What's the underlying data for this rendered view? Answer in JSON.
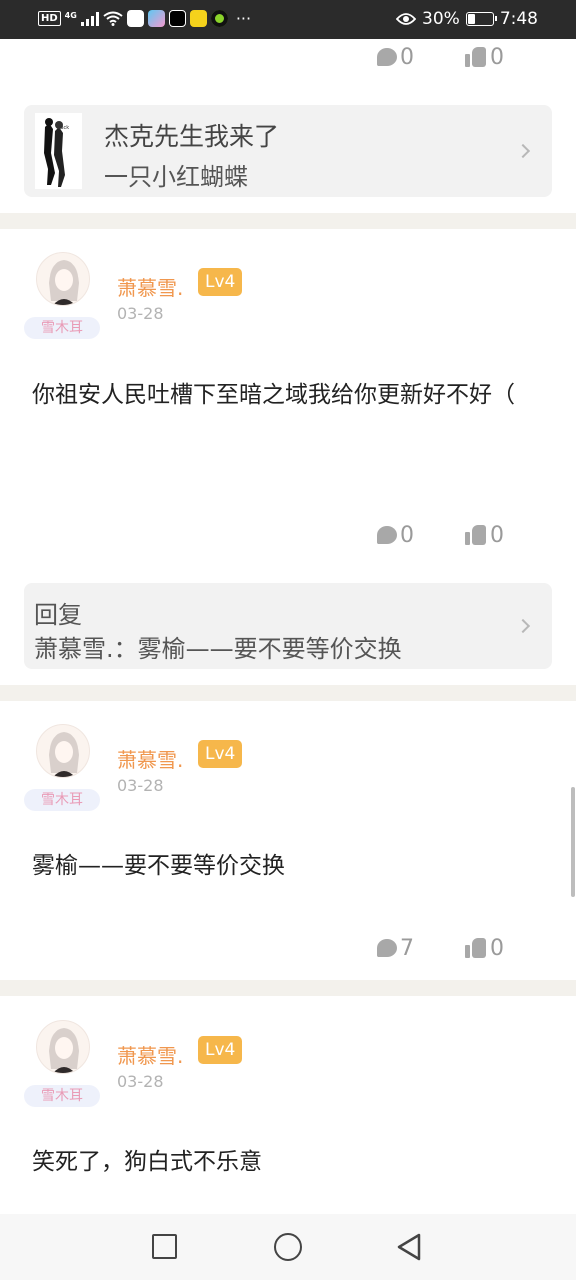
{
  "status_bar": {
    "hd": "HD",
    "network": "4G",
    "battery_percent": "30%",
    "battery_level": 0.3,
    "time": "7:48",
    "more": "···",
    "icons": [
      "wifi-icon",
      "app-icon",
      "app-icon",
      "capcut-icon",
      "app-icon",
      "app-icon",
      "eye-icon",
      "battery-icon"
    ]
  },
  "top_stats": {
    "comments": "0",
    "likes": "0"
  },
  "book_card": {
    "title": "杰克先生我来了",
    "author": "一只小红蝴蝶",
    "cover_caption": "Jack"
  },
  "posts": [
    {
      "username": "萧慕雪.",
      "level": "Lv4",
      "date": "03-28",
      "badge": "雪木耳",
      "content": "你祖安人民吐槽下至暗之域我给你更新好不好（",
      "comments": "0",
      "likes": "0",
      "reply": {
        "label": "回复",
        "text": "萧慕雪.：雾榆——要不要等价交换"
      }
    },
    {
      "username": "萧慕雪.",
      "level": "Lv4",
      "date": "03-28",
      "badge": "雪木耳",
      "content": "雾榆——要不要等价交换",
      "comments": "7",
      "likes": "0"
    },
    {
      "username": "萧慕雪.",
      "level": "Lv4",
      "date": "03-28",
      "badge": "雪木耳",
      "content": "笑死了，狗白式不乐意"
    }
  ],
  "colors": {
    "status_bar_bg": "#2b2b2b",
    "username": "#f0974e",
    "level_badge": "#f6b74b",
    "divider": "#f3f1ec",
    "card_bg": "#f2f2f2"
  }
}
